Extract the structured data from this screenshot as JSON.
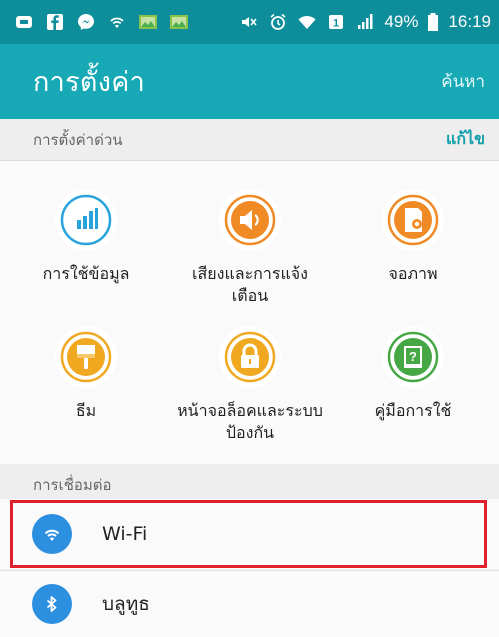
{
  "status_bar": {
    "battery_percent": "49%",
    "time": "16:19",
    "icons": [
      "dropbox-icon",
      "facebook-icon",
      "messenger-icon",
      "wifi-icon",
      "image-icon",
      "image-icon",
      "mute-icon",
      "alarm-icon",
      "wifi-icon",
      "data-icon",
      "signal-icon",
      "battery-icon"
    ]
  },
  "app_bar": {
    "title": "การตั้งค่า",
    "search_label": "ค้นหา"
  },
  "quick_settings": {
    "header": "การตั้งค่าด่วน",
    "edit_label": "แก้ไข",
    "items": [
      {
        "label": "การใช้ข้อมูล",
        "icon": "data-usage-icon",
        "color": "#29a3dc"
      },
      {
        "label": "เสียงและการแจ้งเตือน",
        "icon": "sound-icon",
        "color": "#f08a24"
      },
      {
        "label": "จอภาพ",
        "icon": "display-icon",
        "color": "#f08a24"
      },
      {
        "label": "ธีม",
        "icon": "theme-brush-icon",
        "color": "#f0a820"
      },
      {
        "label": "หน้าจอล็อคและระบบป้องกัน",
        "icon": "lock-icon",
        "color": "#f0a820"
      },
      {
        "label": "คู่มือการใช้",
        "icon": "help-book-icon",
        "color": "#45a845"
      }
    ]
  },
  "connections": {
    "header": "การเชื่อมต่อ",
    "items": [
      {
        "label": "Wi-Fi",
        "icon": "wifi-icon",
        "color": "#2d8fe0"
      },
      {
        "label": "บลูทูธ",
        "icon": "bluetooth-icon",
        "color": "#2d8fe0"
      }
    ]
  },
  "colors": {
    "status_bar": "#0e8e9b",
    "app_bar": "#17aab6",
    "accent": "#13a0ad",
    "highlight": "#e0202b"
  }
}
